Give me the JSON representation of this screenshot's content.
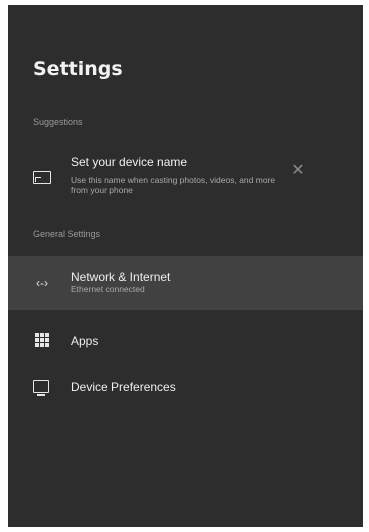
{
  "header": {
    "title": "Settings"
  },
  "suggestions": {
    "section_label": "Suggestions",
    "item": {
      "title": "Set your device name",
      "description": "Use this name when casting photos, videos, and more from your phone",
      "icon": "cast-icon",
      "dismiss_icon": "close-icon",
      "dismiss_glyph": "✕"
    }
  },
  "general": {
    "section_label": "General Settings",
    "items": [
      {
        "label": "Network & Internet",
        "subtitle": "Ethernet connected",
        "icon": "network-arrows-icon",
        "glyph": "‹-›",
        "selected": true
      },
      {
        "label": "Apps",
        "icon": "apps-grid-icon"
      },
      {
        "label": "Device Preferences",
        "icon": "tv-icon"
      }
    ]
  },
  "colors": {
    "background": "#2d2d2d",
    "selected_row": "#414141",
    "text": "#f0f0f0",
    "secondary": "#a9a9a9"
  }
}
